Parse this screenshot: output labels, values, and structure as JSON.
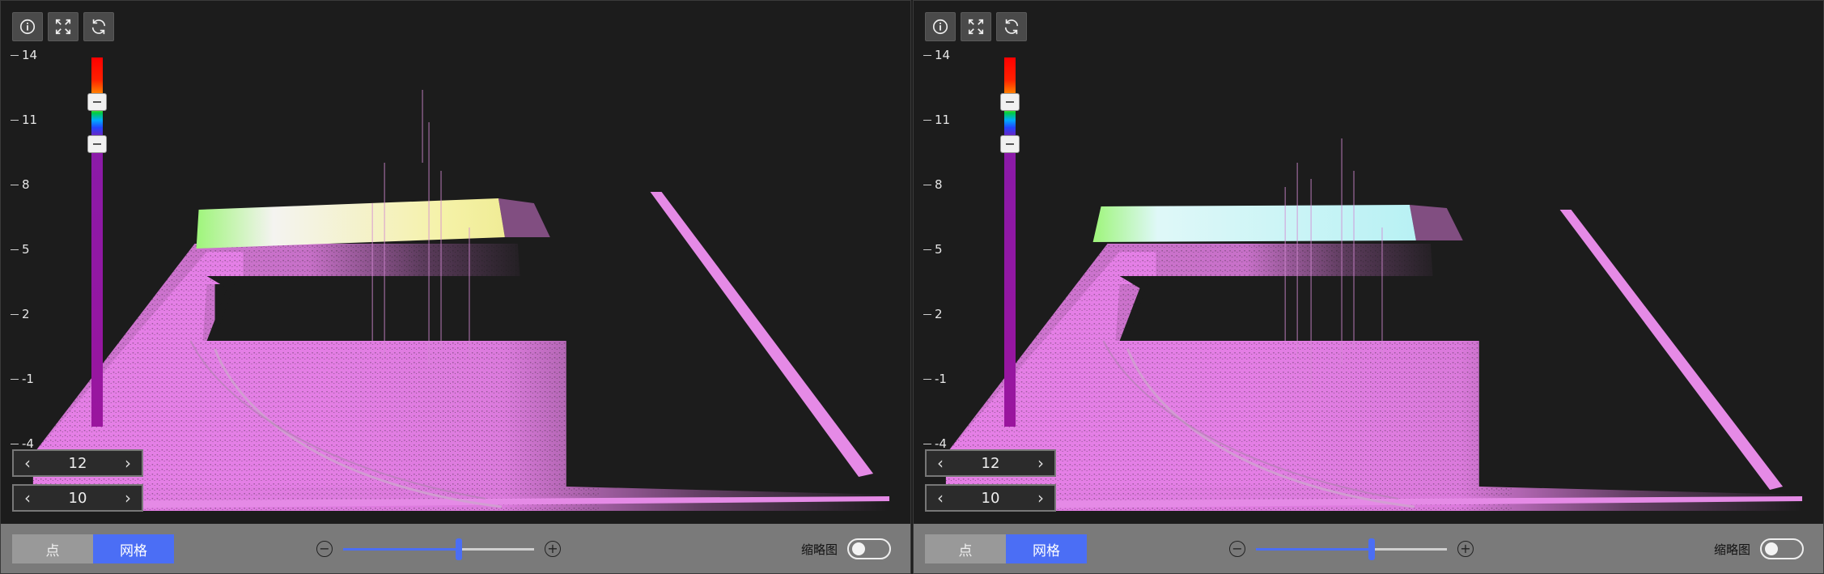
{
  "panes": [
    {
      "id": "left",
      "toolbar": {
        "info_icon": "info-icon",
        "fit_icon": "expand-icon",
        "reset_icon": "refresh-icon"
      },
      "axis_ticks": [
        "14",
        "11",
        "8",
        "5",
        "2",
        "-1",
        "-4"
      ],
      "stepper_top": {
        "value": "12"
      },
      "stepper_bottom": {
        "value": "10"
      },
      "mode": {
        "point_label": "点",
        "mesh_label": "网格",
        "selected": "mesh"
      },
      "zoom_level_fraction": 0.59,
      "thumbnail": {
        "label": "缩略图",
        "enabled": false
      },
      "highlight_color": "#f2f0b0"
    },
    {
      "id": "right",
      "toolbar": {
        "info_icon": "info-icon",
        "fit_icon": "expand-icon",
        "reset_icon": "refresh-icon"
      },
      "axis_ticks": [
        "14",
        "11",
        "8",
        "5",
        "2",
        "-1",
        "-4"
      ],
      "stepper_top": {
        "value": "12"
      },
      "stepper_bottom": {
        "value": "10"
      },
      "mode": {
        "point_label": "点",
        "mesh_label": "网格",
        "selected": "mesh"
      },
      "zoom_level_fraction": 0.59,
      "thumbnail": {
        "label": "缩略图",
        "enabled": false
      },
      "highlight_color": "#c8f4f6"
    }
  ],
  "colors": {
    "cloud": "#e680e6",
    "accent": "#4b6ef5",
    "toolbar": "#4a4a4a"
  }
}
